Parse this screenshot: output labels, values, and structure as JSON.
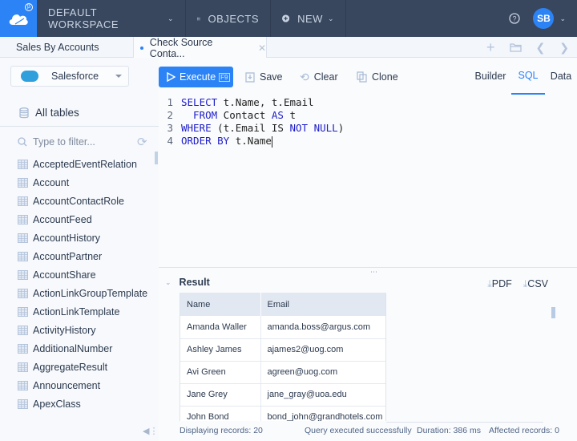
{
  "topbar": {
    "logo_badge": "β",
    "workspace_label": "DEFAULT WORKSPACE",
    "objects_label": "OBJECTS",
    "new_label": "NEW",
    "help_icon": "question-circle",
    "user_initials": "SB"
  },
  "tabs": [
    {
      "label": "Sales By Accounts",
      "active": false
    },
    {
      "label": "Check Source Conta...",
      "active": true,
      "modified": true
    }
  ],
  "sidebar": {
    "connection": "Salesforce",
    "all_tables_label": "All tables",
    "filter_placeholder": "Type to filter...",
    "tables": [
      "AcceptedEventRelation",
      "Account",
      "AccountContactRole",
      "AccountFeed",
      "AccountHistory",
      "AccountPartner",
      "AccountShare",
      "ActionLinkGroupTemplate",
      "ActionLinkTemplate",
      "ActivityHistory",
      "AdditionalNumber",
      "AggregateResult",
      "Announcement",
      "ApexClass"
    ]
  },
  "toolbar": {
    "execute_label": "Execute",
    "execute_shortcut": "F9",
    "save_label": "Save",
    "clear_label": "Clear",
    "clone_label": "Clone",
    "view_tabs": [
      "Builder",
      "SQL",
      "Data"
    ],
    "active_view": "SQL"
  },
  "editor": {
    "lines": [
      {
        "n": "1",
        "tokens": [
          {
            "t": "SELECT",
            "kw": true
          },
          {
            "t": " t.Name, t.Email",
            "kw": false
          }
        ]
      },
      {
        "n": "2",
        "tokens": [
          {
            "t": "  FROM",
            "kw": true
          },
          {
            "t": " Contact ",
            "kw": false
          },
          {
            "t": "AS",
            "kw": true
          },
          {
            "t": " t",
            "kw": false
          }
        ]
      },
      {
        "n": "3",
        "tokens": [
          {
            "t": "WHERE",
            "kw": true
          },
          {
            "t": " (t.Email IS ",
            "kw": false
          },
          {
            "t": "NOT NULL",
            "kw": true
          },
          {
            "t": ")",
            "kw": false
          }
        ]
      },
      {
        "n": "4",
        "tokens": [
          {
            "t": "ORDER BY",
            "kw": true
          },
          {
            "t": " t.Name",
            "kw": false
          }
        ]
      }
    ]
  },
  "result": {
    "title": "Result",
    "export_pdf": "PDF",
    "export_csv": "CSV",
    "columns": [
      "Name",
      "Email"
    ],
    "rows": [
      [
        "Amanda Waller",
        "amanda.boss@argus.com"
      ],
      [
        "Ashley James",
        "ajames2@uog.com"
      ],
      [
        "Avi Green",
        "agreen@uog.com"
      ],
      [
        "Jane Grey",
        "jane_gray@uoa.edu"
      ],
      [
        "John Bond",
        "bond_john@grandhotels.com"
      ]
    ]
  },
  "status": {
    "displaying": "Displaying records: 20",
    "message": "Query executed successfully",
    "duration": "Duration: 386 ms",
    "affected": "Affected records: 0"
  },
  "colors": {
    "accent": "#2b83f6",
    "topbar": "#38475e",
    "keyword": "#1d1dc8"
  }
}
